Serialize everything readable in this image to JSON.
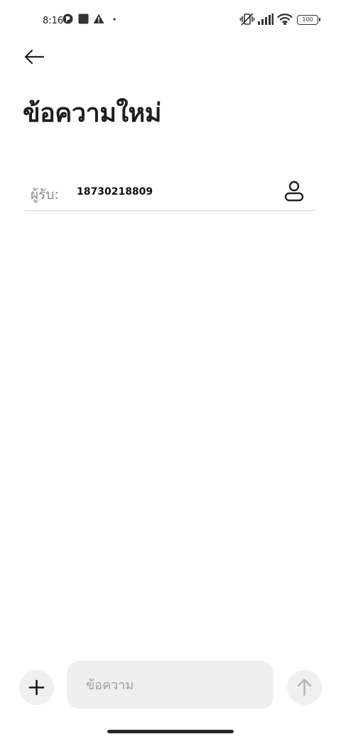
{
  "status_bar": {
    "time": "8:16",
    "battery_level": "100",
    "icons": [
      "app-notification-icon",
      "square-notification-icon",
      "warning-icon",
      "dot-icon",
      "vibrate-off-icon",
      "signal-icon",
      "wifi-icon",
      "battery-icon"
    ]
  },
  "header": {
    "back_icon": "arrow-left-icon",
    "title": "ข้อความใหม่"
  },
  "recipient": {
    "label": "ผู้รับ:",
    "value": "18730218809",
    "contact_icon": "person-icon"
  },
  "composer": {
    "add_icon": "plus-icon",
    "placeholder": "ข้อความ",
    "value": "",
    "send_icon": "arrow-up-icon"
  },
  "colors": {
    "background": "#ffffff",
    "text": "#1e1e1e",
    "muted": "#888888",
    "input_bg": "#efefef",
    "button_bg": "#f0f0f0",
    "send_disabled": "#b3b3b3"
  }
}
